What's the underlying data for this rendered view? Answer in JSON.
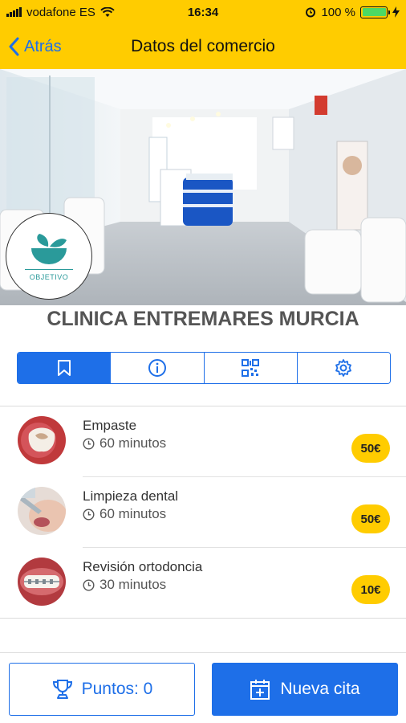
{
  "status_bar": {
    "carrier": "vodafone ES",
    "time": "16:34",
    "battery": "100 %",
    "battery_level": 1.0
  },
  "nav": {
    "back_label": "Atrás",
    "title": "Datos del comercio"
  },
  "business": {
    "logo_text": "OBJETIVO",
    "name": "CLINICA ENTREMARES MURCIA"
  },
  "tabs": [
    {
      "icon": "bookmark-icon",
      "active": true
    },
    {
      "icon": "info-icon",
      "active": false
    },
    {
      "icon": "qr-code-icon",
      "active": false
    },
    {
      "icon": "gear-icon",
      "active": false
    }
  ],
  "services": [
    {
      "name": "Empaste",
      "duration": "60 minutos",
      "price": "50€"
    },
    {
      "name": "Limpieza dental",
      "duration": "60 minutos",
      "price": "50€"
    },
    {
      "name": "Revisión ortodoncia",
      "duration": "30 minutos",
      "price": "10€"
    }
  ],
  "bottom": {
    "points_label": "Puntos: 0",
    "new_appointment_label": "Nueva cita"
  },
  "colors": {
    "brand_yellow": "#FFCC00",
    "accent_blue": "#1E6FE8"
  }
}
